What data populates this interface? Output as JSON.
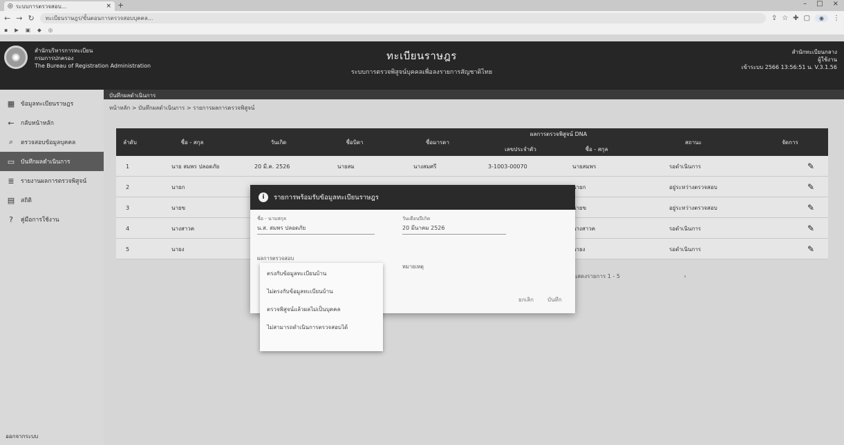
{
  "browser": {
    "tab_title": "ระบบการตรวจสอบ...",
    "url": "ทะเบียนราษฎร/ขั้นตอนการตรวจสอบบุคคล..."
  },
  "app": {
    "org_line1": "สำนักบริหารการทะเบียน",
    "org_line2": "กรมการปกครอง",
    "org_line3": "The Bureau of Registration Administration",
    "title": "ทะเบียนราษฎร",
    "subtitle": "ระบบการตรวจพิสูจน์บุคคลเพื่อลงรายการสัญชาติไทย",
    "user_line1": "สำนักทะเบียนกลาง",
    "user_line2": "ผู้ใช้งาน",
    "user_line3": "เข้าระบบ 2566 13:56:51 น. V.3.1.56",
    "subbar": "บันทึกผลดำเนินการ"
  },
  "sidebar": {
    "items": [
      {
        "icon": "grid-icon",
        "glyph": "▦",
        "label": "ข้อมูลทะเบียนราษฎร"
      },
      {
        "icon": "back-icon",
        "glyph": "←",
        "label": "กลับหน้าหลัก"
      },
      {
        "icon": "search-icon",
        "glyph": "⌕",
        "label": "ตรวจสอบข้อมูลบุคคล"
      },
      {
        "icon": "document-icon",
        "glyph": "▭",
        "label": "บันทึกผลดำเนินการ"
      },
      {
        "icon": "list-icon",
        "glyph": "≣",
        "label": "รายงานผลการตรวจพิสูจน์"
      },
      {
        "icon": "chart-icon",
        "glyph": "▤",
        "label": "สถิติ"
      },
      {
        "icon": "help-icon",
        "glyph": "?",
        "label": "คู่มือการใช้งาน"
      }
    ],
    "footer": "ออกจากระบบ"
  },
  "breadcrumb": "หน้าหลัก > บันทึกผลดำเนินการ > รายการผลการตรวจพิสูจน์",
  "table": {
    "headers": {
      "no": "ลำดับ",
      "name": "ชื่อ - สกุล",
      "dob": "วันเกิด",
      "father": "ชื่อบิดา",
      "mother": "ชื่อมารดา",
      "dna_group": "ผลการตรวจพิสูจน์ DNA",
      "dna_id": "เลขประจำตัว",
      "dna_name": "ชื่อ - สกุล",
      "status": "สถานะ",
      "manage": "จัดการ"
    },
    "rows": [
      {
        "no": "1",
        "name": "นาย สมพร ปลอดภัย",
        "dob": "20 มี.ค. 2526",
        "father": "นายสม",
        "mother": "นางสมศรี",
        "dna_id": "3-1003-00070",
        "dna_name": "นายสมพร",
        "status": "รอดำเนินการ"
      },
      {
        "no": "2",
        "name": "นายก",
        "dob": "",
        "father": "",
        "mother": "",
        "dna_id": "",
        "dna_name": "นายก",
        "status": "อยู่ระหว่างตรวจสอบ"
      },
      {
        "no": "3",
        "name": "นายข",
        "dob": "",
        "father": "",
        "mother": "",
        "dna_id": "",
        "dna_name": "นายข",
        "status": "อยู่ระหว่างตรวจสอบ"
      },
      {
        "no": "4",
        "name": "นางสาวค",
        "dob": "",
        "father": "",
        "mother": "",
        "dna_id": "",
        "dna_name": "นางสาวค",
        "status": "รอดำเนินการ"
      },
      {
        "no": "5",
        "name": "นายง",
        "dob": "",
        "father": "",
        "mother": "",
        "dna_id": "",
        "dna_name": "นายง",
        "status": "รอดำเนินการ"
      }
    ],
    "pager": "แสดงรายการ 1 - 5"
  },
  "modal": {
    "title": "รายการพร้อมรับข้อมูลทะเบียนราษฎร",
    "name_label": "ชื่อ - นามสกุล",
    "name_value": "น.ส. สมพร ปลอดภัย",
    "dob_label": "วันเดือนปีเกิด",
    "dob_value": "20 มีนาคม 2526",
    "select_label": "ผลการตรวจสอบ",
    "right_label": "หมายเหตุ",
    "cancel_label": "ยกเลิก",
    "save_label": "บันทึก"
  },
  "dropdown": {
    "options": [
      "ตรงกับข้อมูลทะเบียนบ้าน",
      "ไม่ตรงกับข้อมูลทะเบียนบ้าน",
      "ตรวจพิสูจน์แล้วผลไม่เป็นบุคคล",
      "ไม่สามารถดำเนินการตรวจสอบได้"
    ]
  }
}
